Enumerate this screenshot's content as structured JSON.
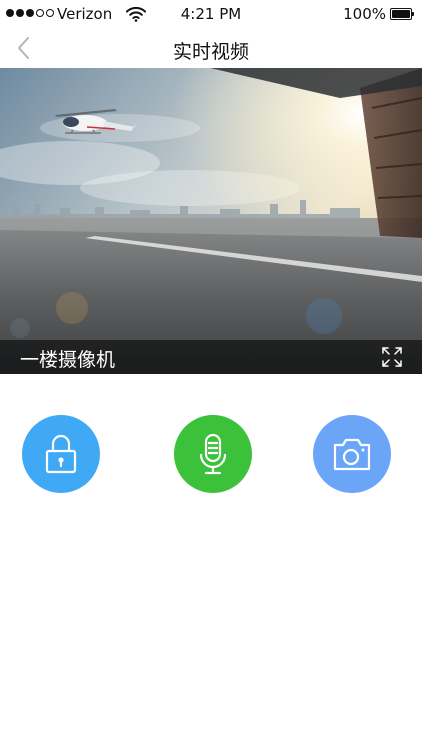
{
  "status_bar": {
    "carrier": "Verizon",
    "time": "4:21 PM",
    "battery_percent": "100%",
    "signal_bars": 3,
    "signal_total": 5
  },
  "nav": {
    "title": "实时视频",
    "back_icon": "chevron-left-icon"
  },
  "video": {
    "camera_name": "一楼摄像机",
    "fullscreen_icon": "fullscreen-icon"
  },
  "actions": [
    {
      "name": "lock",
      "icon": "lock-icon",
      "color": "#3fa9f5"
    },
    {
      "name": "microphone",
      "icon": "microphone-icon",
      "color": "#3cc13b"
    },
    {
      "name": "camera",
      "icon": "camera-icon",
      "color": "#6aa5f7"
    }
  ],
  "colors": {
    "lock_button": "#3fa9f5",
    "mic_button": "#3cc13b",
    "camera_button": "#6aa5f7",
    "back_chevron": "#b5b5b5"
  }
}
